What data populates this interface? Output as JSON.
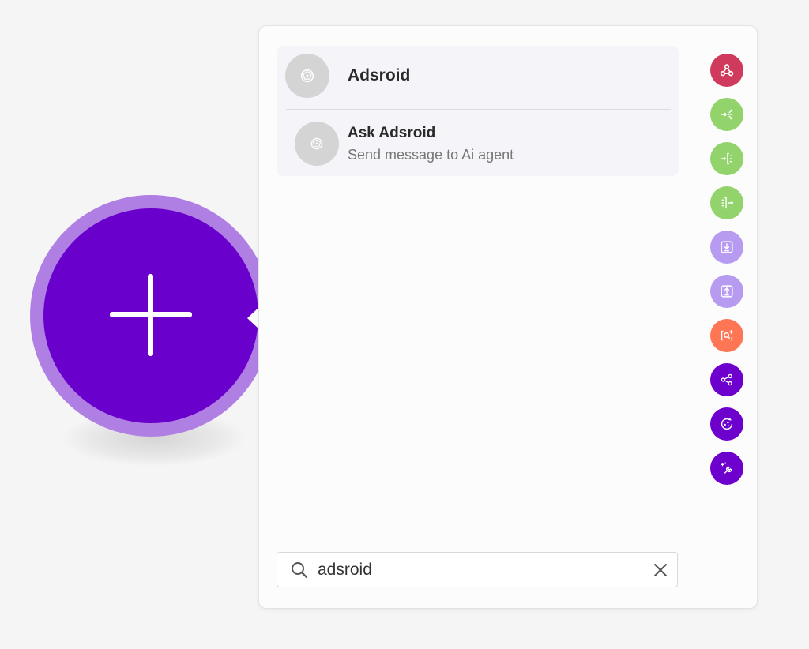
{
  "app_group": {
    "title": "Adsroid",
    "modules": [
      {
        "title": "Ask Adsroid",
        "description": "Send message to Ai agent"
      }
    ]
  },
  "side_icons": [
    {
      "icon": "webhook-icon",
      "color": "#cf3a5d"
    },
    {
      "icon": "flow-router-icon",
      "color": "#92d36b"
    },
    {
      "icon": "array-aggregator-icon",
      "color": "#92d36b"
    },
    {
      "icon": "iterator-icon",
      "color": "#92d36b"
    },
    {
      "icon": "import-icon",
      "color": "#b79bf0"
    },
    {
      "icon": "export-icon",
      "color": "#b79bf0"
    },
    {
      "icon": "search-add-icon",
      "color": "#ff7654"
    },
    {
      "icon": "share-icon",
      "color": "#6d00cc"
    },
    {
      "icon": "ai-agent-icon",
      "color": "#6d00cc"
    },
    {
      "icon": "tools-icon",
      "color": "#6d00cc"
    }
  ],
  "search": {
    "value": "adsroid"
  },
  "colors": {
    "add_button": "#6a00cc",
    "add_button_ring": "#b07fe3",
    "panel_background": "#fcfcfc"
  }
}
